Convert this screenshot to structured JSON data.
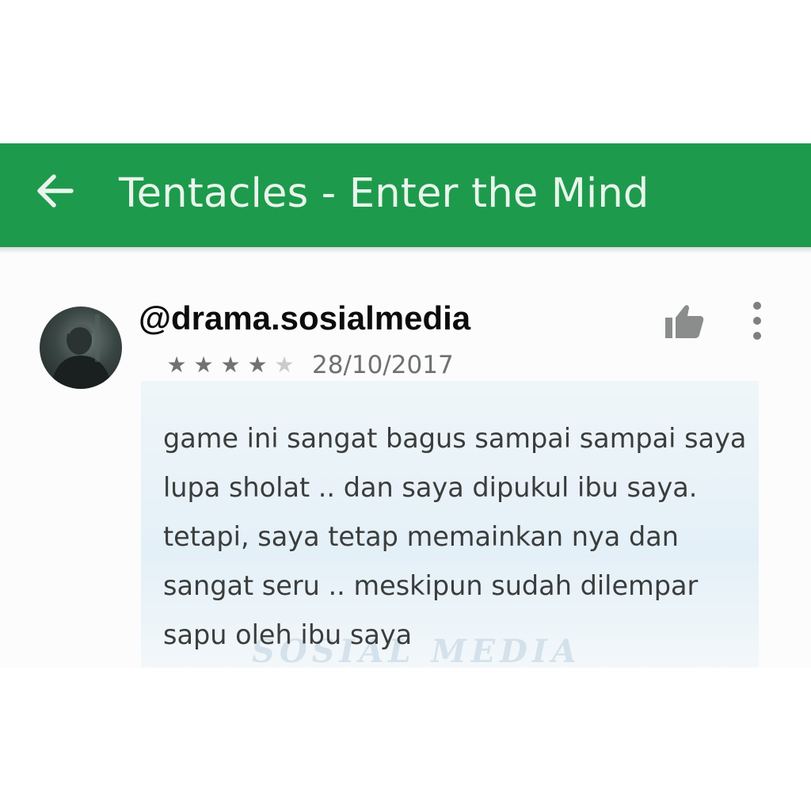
{
  "toolbar": {
    "title": "Tentacles - Enter the Mind",
    "back_icon": "arrow-left-icon",
    "color": "#1e9a4c"
  },
  "watermark": {
    "handle": "@drama.sosialmedia",
    "logo_text": "SOSIAL MEDIA"
  },
  "review": {
    "avatar_icon": "user-avatar",
    "rating": 4,
    "rating_max": 5,
    "stars": [
      "★",
      "★",
      "★",
      "★",
      "★"
    ],
    "date": "28/10/2017",
    "lines": [
      "game ini sangat bagus sampai sampai saya",
      "lupa sholat .. dan saya dipukul ibu saya.",
      "tetapi, saya tetap memainkan nya dan",
      "sangat seru .. meskipun sudah dilempar",
      "sapu oleh ibu saya"
    ],
    "actions": {
      "like_icon": "thumbs-up-icon",
      "more_icon": "more-vertical-icon"
    }
  }
}
